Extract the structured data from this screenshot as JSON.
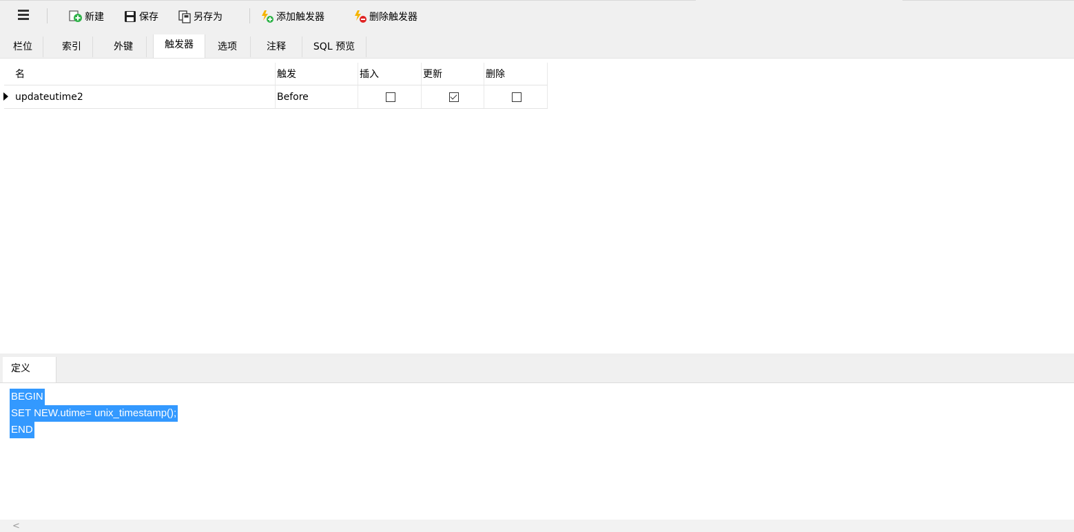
{
  "toolbar": {
    "new_label": "新建",
    "save_label": "保存",
    "save_as_label": "另存为",
    "add_trigger_label": "添加触发器",
    "delete_trigger_label": "删除触发器"
  },
  "tabs": [
    {
      "label": "栏位"
    },
    {
      "label": "索引"
    },
    {
      "label": "外键"
    },
    {
      "label": "触发器",
      "active": true
    },
    {
      "label": "选项"
    },
    {
      "label": "注释"
    },
    {
      "label": "SQL 预览"
    }
  ],
  "grid": {
    "columns": [
      "名",
      "触发",
      "插入",
      "更新",
      "删除"
    ],
    "rows": [
      {
        "name": "updateutime2",
        "fire": "Before",
        "insert": false,
        "update": true,
        "delete": false
      }
    ]
  },
  "definition": {
    "tab_label": "定义",
    "code_lines": [
      "BEGIN",
      "SET NEW.utime= unix_timestamp();",
      "END"
    ]
  },
  "colors": {
    "selection": "#3399ff",
    "toolbar_bg": "#f0f0f0"
  },
  "icons": [
    "menu-icon",
    "new-icon",
    "save-icon",
    "save-as-icon",
    "add-trigger-icon",
    "delete-trigger-icon"
  ]
}
